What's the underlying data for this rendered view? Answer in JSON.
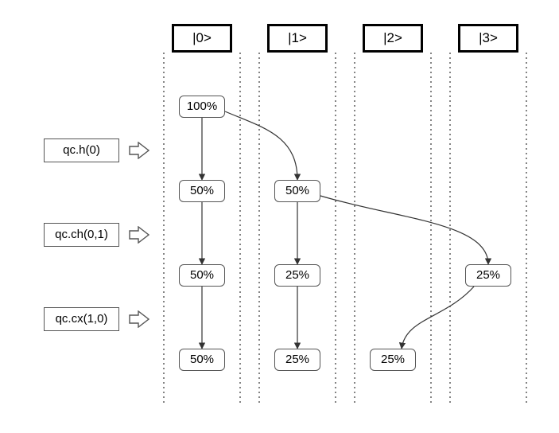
{
  "states": {
    "s0": "|0>",
    "s1": "|1>",
    "s2": "|2>",
    "s3": "|3>"
  },
  "gates": {
    "g1": "qc.h(0)",
    "g2": "qc.ch(0,1)",
    "g3": "qc.cx(1,0)"
  },
  "probs": {
    "r0c0": "100%",
    "r1c0": "50%",
    "r1c1": "50%",
    "r2c0": "50%",
    "r2c1": "25%",
    "r2c3": "25%",
    "r3c0": "50%",
    "r3c1": "25%",
    "r3c2": "25%"
  }
}
